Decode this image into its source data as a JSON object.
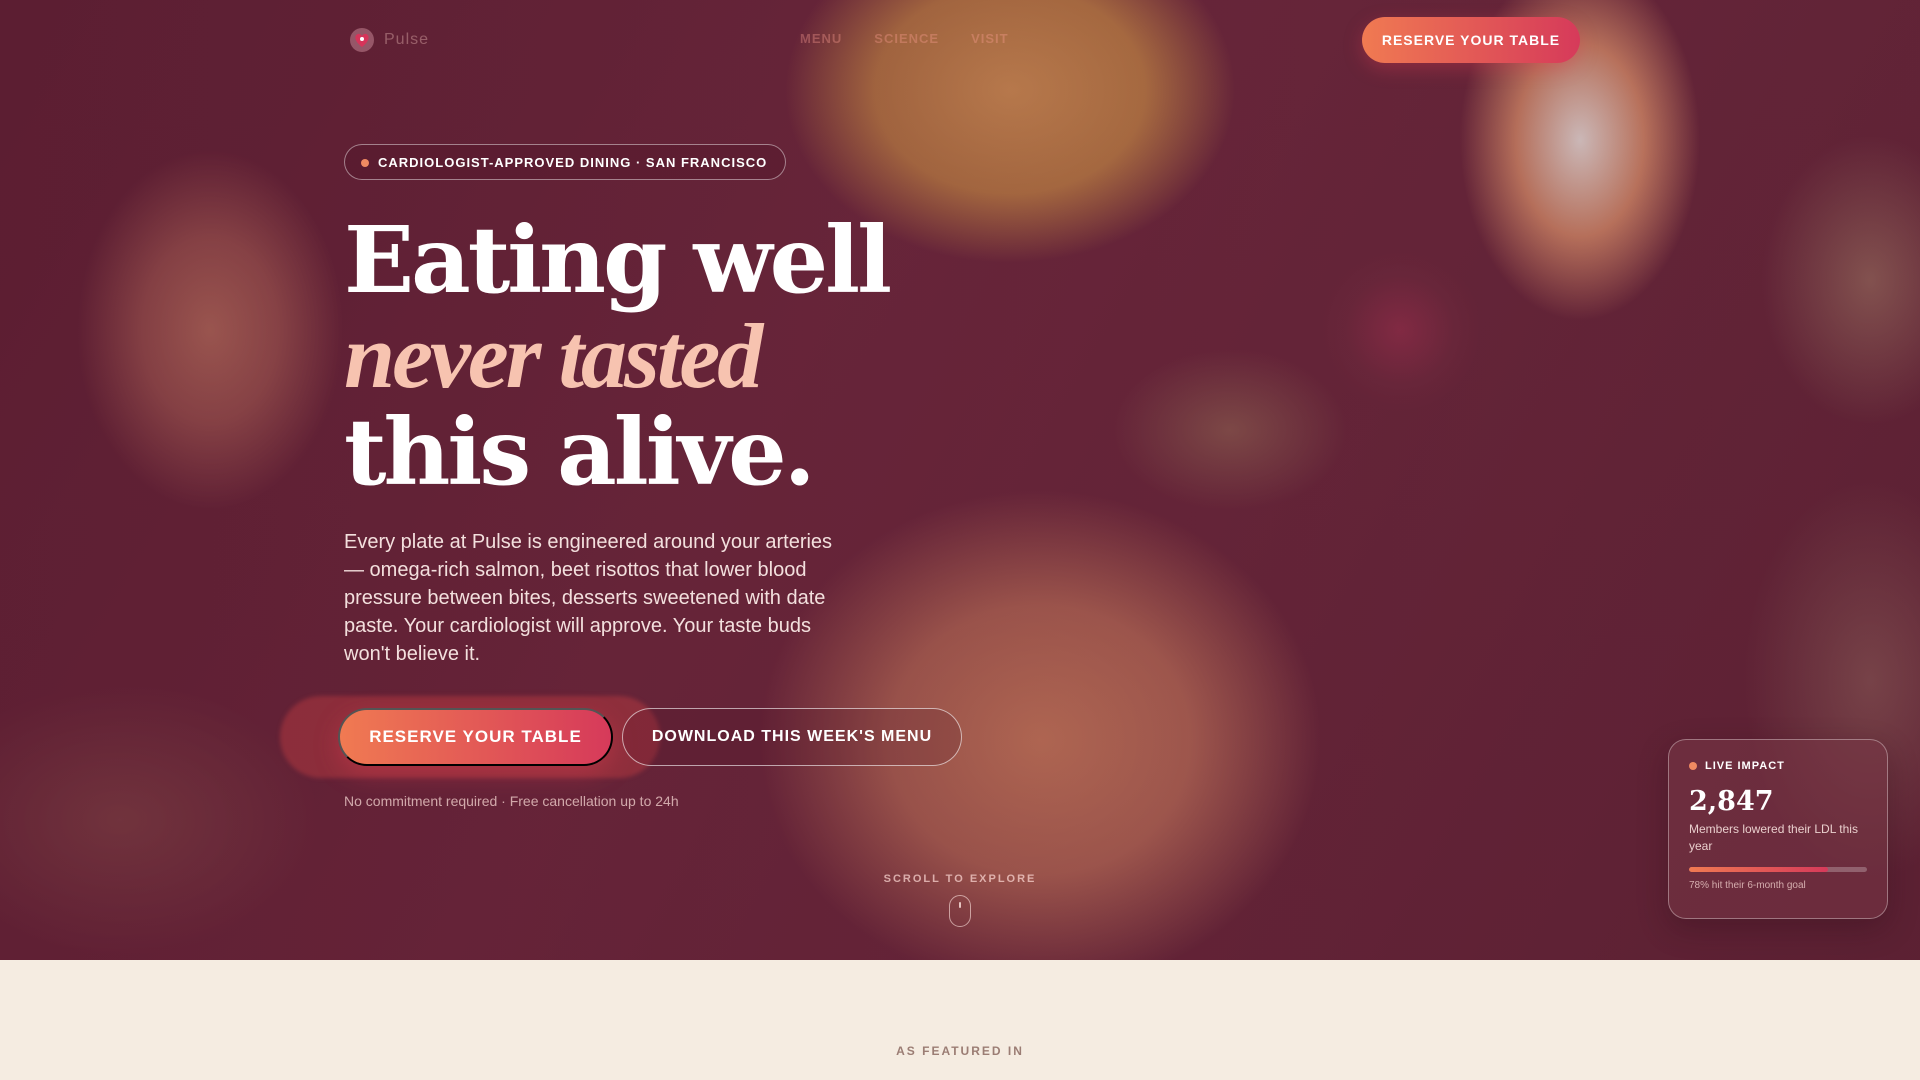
{
  "brand": {
    "name": "Pulse"
  },
  "nav": {
    "links": [
      "MENU",
      "SCIENCE",
      "VISIT"
    ],
    "cta": "RESERVE YOUR TABLE"
  },
  "hero": {
    "badge": "CARDIOLOGIST-APPROVED DINING · SAN FRANCISCO",
    "headline_1": "Eating well",
    "headline_2": "never tasted",
    "headline_3": "this alive.",
    "lede": "Every plate at Pulse is engineered around your arteries — omega-rich salmon, beet risottos that lower blood pressure between bites, desserts sweetened with date paste. Your cardiologist will approve. Your taste buds won't believe it.",
    "cta_primary": "RESERVE YOUR TABLE",
    "cta_secondary": "DOWNLOAD THIS WEEK'S MENU",
    "fineprint": "No commitment required · Free cancellation up to 24h",
    "scroll_label": "SCROLL TO EXPLORE"
  },
  "impact": {
    "label": "LIVE IMPACT",
    "number": "2,847",
    "description": "Members lowered their LDL this year",
    "progress": 0.78,
    "note": "78% hit their 6-month goal"
  },
  "featured": {
    "label": "AS FEATURED IN"
  },
  "colors": {
    "accent_start": "#f07a52",
    "accent_end": "#d63a5a",
    "hero_base": "#5e2438",
    "page_bg": "#f5ece1"
  }
}
